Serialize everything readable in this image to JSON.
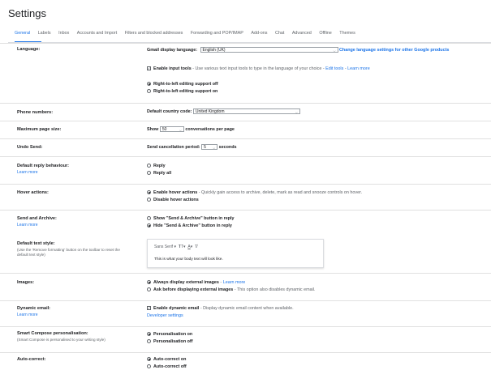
{
  "title": "Settings",
  "tabs": [
    {
      "label": "General",
      "active": true
    },
    {
      "label": "Labels"
    },
    {
      "label": "Inbox"
    },
    {
      "label": "Accounts and Import"
    },
    {
      "label": "Filters and blocked addresses"
    },
    {
      "label": "Forwarding and POP/IMAP"
    },
    {
      "label": "Add-ons"
    },
    {
      "label": "Chat"
    },
    {
      "label": "Advanced"
    },
    {
      "label": "Offline"
    },
    {
      "label": "Themes"
    }
  ],
  "language": {
    "label": "Language:",
    "display_label": "Gmail display language:",
    "display_value": "English (UK)",
    "change_link": "Change language settings for other Google products",
    "input_tools_bold": "Enable input tools",
    "input_tools_desc": "- Use various text input tools to type in the language of your choice -",
    "edit_tools": "Edit tools",
    "learn_more": "Learn more",
    "rtl_off": "Right-to-left editing support off",
    "rtl_on": "Right-to-left editing support on"
  },
  "phone": {
    "label": "Phone numbers:",
    "country_label": "Default country code:",
    "country_value": "United Kingdom"
  },
  "page_size": {
    "label": "Maximum page size:",
    "show": "Show",
    "value": "50",
    "suffix": "conversations per page"
  },
  "undo": {
    "label": "Undo Send:",
    "period_label": "Send cancellation period:",
    "value": "5",
    "suffix": "seconds"
  },
  "reply": {
    "label": "Default reply behaviour:",
    "learn_more": "Learn more",
    "reply": "Reply",
    "reply_all": "Reply all"
  },
  "hover": {
    "label": "Hover actions:",
    "enable_bold": "Enable hover actions",
    "enable_desc": "- Quickly gain access to archive, delete, mark as read and snooze controls on hover.",
    "disable": "Disable hover actions"
  },
  "send_archive": {
    "label": "Send and Archive:",
    "learn_more": "Learn more",
    "show": "Show \"Send & Archive\" button in reply",
    "hide": "Hide \"Send & Archive\" button in reply"
  },
  "text_style": {
    "label": "Default text style:",
    "note": "(Use the 'Remove formatting' button on the toolbar to reset the default text style)",
    "font": "Sans Serif",
    "size_icon": "ᴛᴛ",
    "color_icon": "A",
    "remove_icon": "T̸",
    "preview": "This is what your body text will look like."
  },
  "images": {
    "label": "Images:",
    "always_bold": "Always display external images",
    "learn_more": "Learn more",
    "ask_bold": "Ask before displaying external images",
    "ask_desc": "- This option also disables dynamic email."
  },
  "dynamic": {
    "label": "Dynamic email:",
    "learn_more": "Learn more",
    "enable_bold": "Enable dynamic email",
    "enable_desc": "- Display dynamic email content when available.",
    "dev": "Developer settings"
  },
  "smart_compose": {
    "label": "Smart Compose personalisation:",
    "note": "(Smart Compose is personalised to your writing style)",
    "on": "Personalisation on",
    "off": "Personalisation off"
  },
  "autocorrect": {
    "label": "Auto-correct:",
    "on": "Auto-correct on",
    "off": "Auto-correct off"
  }
}
